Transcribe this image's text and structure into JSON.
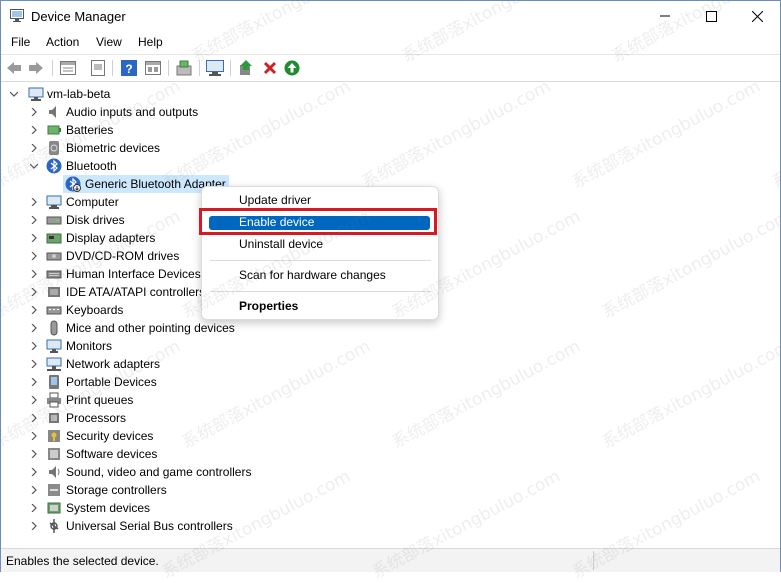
{
  "window": {
    "title": "Device Manager"
  },
  "menu": [
    "File",
    "Action",
    "View",
    "Help"
  ],
  "toolbar": [
    "back-arrow-icon",
    "forward-arrow-icon",
    "properties-icon",
    "show-hidden-icon",
    "help-icon",
    "view-icon",
    "update-driver-icon",
    "monitor-icon",
    "add-driver-icon",
    "uninstall-icon",
    "enable-icon"
  ],
  "tree": {
    "root": "vm-lab-beta",
    "items": [
      {
        "label": "Audio inputs and outputs",
        "icon": "speaker-icon"
      },
      {
        "label": "Batteries",
        "icon": "battery-icon"
      },
      {
        "label": "Biometric devices",
        "icon": "biometric-icon"
      },
      {
        "label": "Bluetooth",
        "icon": "bluetooth-icon",
        "expanded": true
      },
      {
        "label": "Generic Bluetooth Adapter",
        "icon": "bluetooth-disabled-icon",
        "child": true,
        "selected": true
      },
      {
        "label": "Computer",
        "icon": "computer-icon"
      },
      {
        "label": "Disk drives",
        "icon": "disk-icon"
      },
      {
        "label": "Display adapters",
        "icon": "display-icon"
      },
      {
        "label": "DVD/CD-ROM drives",
        "icon": "dvd-icon"
      },
      {
        "label": "Human Interface Devices",
        "icon": "hid-icon"
      },
      {
        "label": "IDE ATA/ATAPI controllers",
        "icon": "ide-icon"
      },
      {
        "label": "Keyboards",
        "icon": "keyboard-icon"
      },
      {
        "label": "Mice and other pointing devices",
        "icon": "mouse-icon"
      },
      {
        "label": "Monitors",
        "icon": "monitor-icon"
      },
      {
        "label": "Network adapters",
        "icon": "network-icon"
      },
      {
        "label": "Portable Devices",
        "icon": "portable-icon"
      },
      {
        "label": "Print queues",
        "icon": "printer-icon"
      },
      {
        "label": "Processors",
        "icon": "processor-icon"
      },
      {
        "label": "Security devices",
        "icon": "security-icon"
      },
      {
        "label": "Software devices",
        "icon": "software-icon"
      },
      {
        "label": "Sound, video and game controllers",
        "icon": "sound-icon"
      },
      {
        "label": "Storage controllers",
        "icon": "storage-icon"
      },
      {
        "label": "System devices",
        "icon": "system-icon"
      },
      {
        "label": "Universal Serial Bus controllers",
        "icon": "usb-icon"
      }
    ]
  },
  "context_menu": {
    "update": "Update driver",
    "enable": "Enable device",
    "uninstall": "Uninstall device",
    "scan": "Scan for hardware changes",
    "properties": "Properties"
  },
  "status": "Enables the selected device.",
  "watermark": "系统部落xitongbuluo.com",
  "colors": {
    "highlight": "#0067c0",
    "selection": "#cce8ff",
    "callout": "#d71921"
  }
}
